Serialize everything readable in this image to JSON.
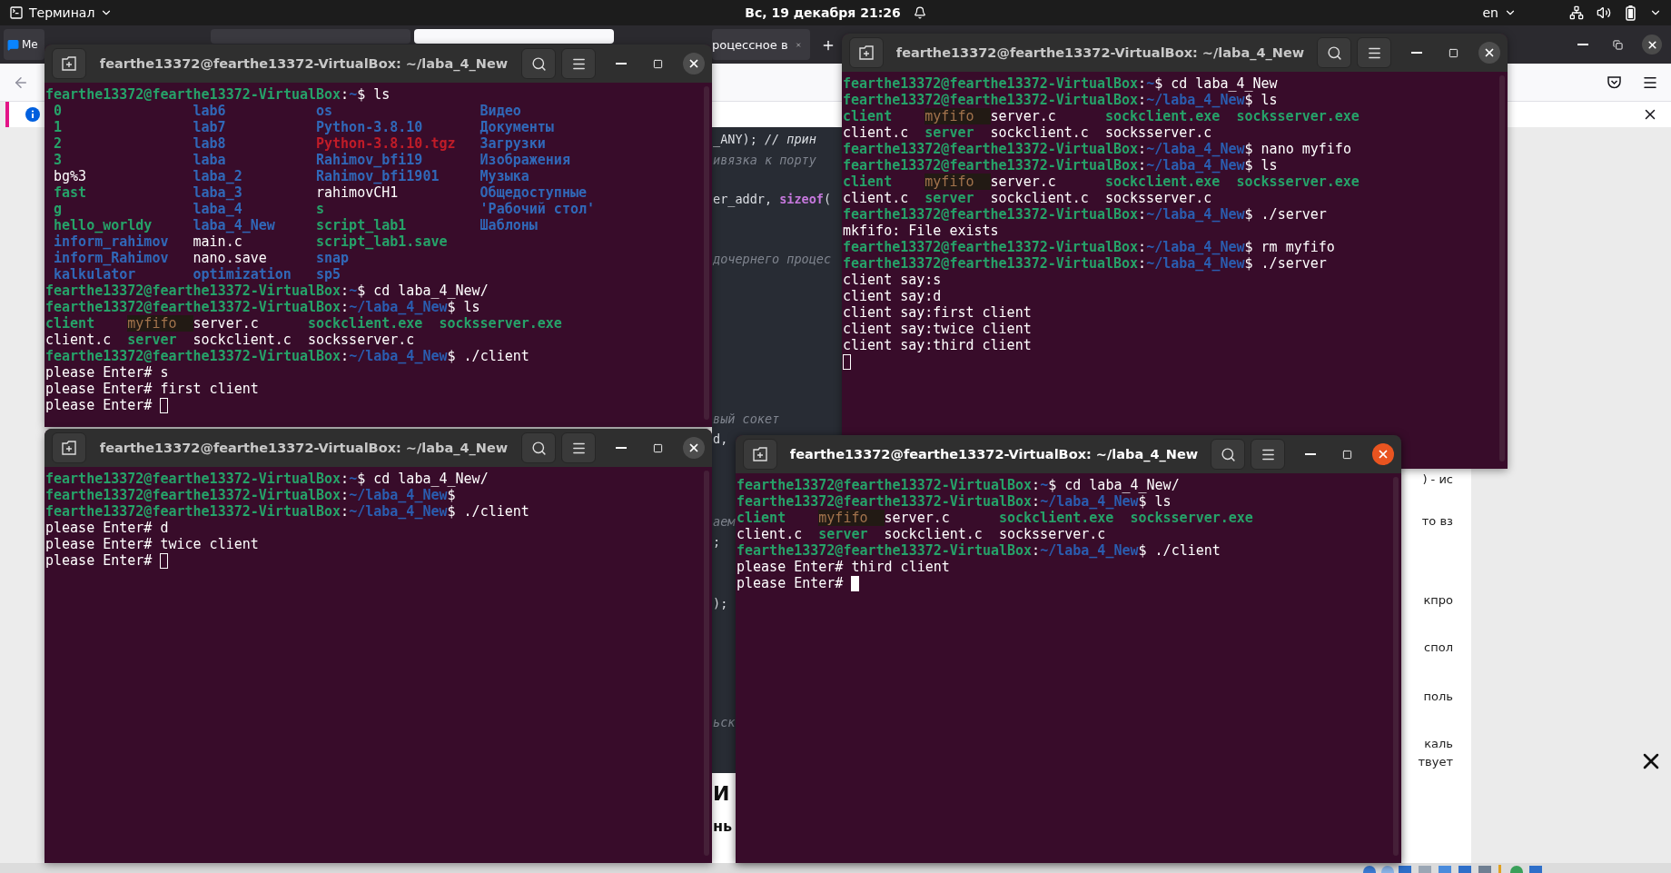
{
  "top_bar": {
    "menu": "Терминал",
    "clock": "Вс, 19 декабря 21:26",
    "language": "en"
  },
  "browser": {
    "tabs": [
      {
        "label": "Ме",
        "selected": false
      },
      {
        "selected": false
      },
      {
        "selected": true
      },
      {
        "label": "роцессное в",
        "selected": false
      }
    ],
    "code_lines": [
      {
        "text": "_ANY); *// прин*",
        "kind": "code"
      },
      {
        "text": "ивязка к порту",
        "kind": "comment"
      },
      {
        "text": "er_addr, **sizeof**(",
        "kind": "code"
      },
      {
        "text": "дочернего процес",
        "kind": "comment"
      },
      {
        "text": "вый сокет",
        "kind": "comment"
      },
      {
        "text": "d,",
        "kind": "code"
      },
      {
        "text": "аем",
        "kind": "comment"
      },
      {
        "text": ";",
        "kind": "code"
      },
      {
        "text": ");",
        "kind": "code"
      },
      {
        "text": "ьск",
        "kind": "comment"
      }
    ],
    "article_fragments": [
      "И",
      "нь"
    ],
    "list_items": [
      {
        "lines": [
          ") - ис"
        ]
      },
      {
        "lines": [
          "то вз"
        ]
      },
      {
        "lines": [
          "кпро"
        ]
      },
      {
        "lines": [
          "спол"
        ]
      },
      {
        "lines": [
          "поль"
        ]
      },
      {
        "lines": [
          "каль",
          "твует"
        ]
      }
    ]
  },
  "terminals": [
    {
      "title": "fearthe13372@fearthe13372-VirtualBox: ~/laba_4_New",
      "active": false,
      "lines": [
        {
          "segments": [
            {
              "text": "fearthe13372@fearthe13372-VirtualBox",
              "kind": "user"
            },
            {
              "text": ":",
              "kind": "plain"
            },
            {
              "text": "~",
              "kind": "path"
            },
            {
              "text": "$ ls",
              "kind": "plain"
            }
          ]
        },
        {
          "quoted": true,
          "columns": [
            [
              {
                "text": "0",
                "kind": "exec"
              },
              {
                "text": "1",
                "kind": "exec"
              },
              {
                "text": "2",
                "kind": "exec"
              },
              {
                "text": "3",
                "kind": "exec"
              },
              {
                "text": "bg%3",
                "kind": "plain"
              },
              {
                "text": "fast",
                "kind": "exec"
              },
              {
                "text": "g",
                "kind": "exec"
              },
              {
                "text": "hello_worldy",
                "kind": "exec"
              },
              {
                "text": "inform_rahimov",
                "kind": "dir"
              },
              {
                "text": "inform_Rahimov",
                "kind": "dir"
              },
              {
                "text": "kalkulator",
                "kind": "dir"
              }
            ],
            [
              {
                "text": "lab6",
                "kind": "dir"
              },
              {
                "text": "lab7",
                "kind": "dir"
              },
              {
                "text": "lab8",
                "kind": "dir"
              },
              {
                "text": "laba",
                "kind": "dir"
              },
              {
                "text": "laba_2",
                "kind": "dir"
              },
              {
                "text": "laba_3",
                "kind": "dir"
              },
              {
                "text": "laba_4",
                "kind": "dir"
              },
              {
                "text": "laba_4_New",
                "kind": "dir"
              },
              {
                "text": "main.c",
                "kind": "plain"
              },
              {
                "text": "nano.save",
                "kind": "plain"
              },
              {
                "text": "optimization",
                "kind": "dir"
              }
            ],
            [
              {
                "text": "os",
                "kind": "dir"
              },
              {
                "text": "Python-3.8.10",
                "kind": "dir"
              },
              {
                "text": "Python-3.8.10.tgz",
                "kind": "archive"
              },
              {
                "text": "Rahimov_bfi19",
                "kind": "dir"
              },
              {
                "text": "Rahimov_bfi1901",
                "kind": "dir"
              },
              {
                "text": "rahimovCH1",
                "kind": "plain"
              },
              {
                "text": "s",
                "kind": "exec"
              },
              {
                "text": "script_lab1",
                "kind": "exec"
              },
              {
                "text": "script_lab1.save",
                "kind": "exec"
              },
              {
                "text": "snap",
                "kind": "dir"
              },
              {
                "text": "sp5",
                "kind": "dir"
              }
            ],
            [
              {
                "text": "Видео",
                "kind": "dir"
              },
              {
                "text": "Документы",
                "kind": "dir"
              },
              {
                "text": "Загрузки",
                "kind": "dir"
              },
              {
                "text": "Изображения",
                "kind": "dir"
              },
              {
                "text": "Музыка",
                "kind": "dir"
              },
              {
                "text": "Общедоступные",
                "kind": "dir"
              },
              {
                "text": "'Рабочий стол'",
                "kind": "dir"
              },
              {
                "text": "Шаблоны",
                "kind": "dir"
              }
            ]
          ]
        },
        {
          "segments": [
            {
              "text": "fearthe13372@fearthe13372-VirtualBox",
              "kind": "user"
            },
            {
              "text": ":",
              "kind": "plain"
            },
            {
              "text": "~",
              "kind": "path"
            },
            {
              "text": "$ cd laba_4_New/",
              "kind": "plain"
            }
          ]
        },
        {
          "segments": [
            {
              "text": "fearthe13372@fearthe13372-VirtualBox",
              "kind": "user"
            },
            {
              "text": ":",
              "kind": "plain"
            },
            {
              "text": "~/laba_4_New",
              "kind": "path"
            },
            {
              "text": "$ ls",
              "kind": "plain"
            }
          ]
        },
        {
          "quoted": false,
          "columns": [
            [
              {
                "text": "client",
                "kind": "exec"
              },
              {
                "text": "client.c",
                "kind": "plain"
              }
            ],
            [
              {
                "text": "myfifo",
                "kind": "fifo"
              },
              {
                "text": "server",
                "kind": "exec"
              }
            ],
            [
              {
                "text": "server.c",
                "kind": "plain"
              },
              {
                "text": "sockclient.c",
                "kind": "plain"
              }
            ],
            [
              {
                "text": "sockclient.exe",
                "kind": "exec"
              },
              {
                "text": "socksserver.c",
                "kind": "plain"
              }
            ],
            [
              {
                "text": "socksserver.exe",
                "kind": "exec"
              }
            ]
          ]
        },
        {
          "segments": [
            {
              "text": "fearthe13372@fearthe13372-VirtualBox",
              "kind": "user"
            },
            {
              "text": ":",
              "kind": "plain"
            },
            {
              "text": "~/laba_4_New",
              "kind": "path"
            },
            {
              "text": "$ ./client",
              "kind": "plain"
            }
          ]
        },
        {
          "segments": [
            {
              "text": "please Enter# s",
              "kind": "plain"
            }
          ]
        },
        {
          "segments": [
            {
              "text": "please Enter# first client",
              "kind": "plain"
            }
          ]
        },
        {
          "segments": [
            {
              "text": "please Enter#",
              "kind": "plain"
            }
          ],
          "cursor": true
        }
      ]
    },
    {
      "title": "fearthe13372@fearthe13372-VirtualBox: ~/laba_4_New",
      "active": false,
      "lines": [
        {
          "segments": [
            {
              "text": "fearthe13372@fearthe13372-VirtualBox",
              "kind": "user"
            },
            {
              "text": ":",
              "kind": "plain"
            },
            {
              "text": "~",
              "kind": "path"
            },
            {
              "text": "$ cd laba_4_New",
              "kind": "plain"
            }
          ]
        },
        {
          "segments": [
            {
              "text": "fearthe13372@fearthe13372-VirtualBox",
              "kind": "user"
            },
            {
              "text": ":",
              "kind": "plain"
            },
            {
              "text": "~/laba_4_New",
              "kind": "path"
            },
            {
              "text": "$ ls",
              "kind": "plain"
            }
          ]
        },
        {
          "quoted": false,
          "columns": [
            [
              {
                "text": "client",
                "kind": "exec"
              },
              {
                "text": "client.c",
                "kind": "plain"
              }
            ],
            [
              {
                "text": "myfifo",
                "kind": "fifo"
              },
              {
                "text": "server",
                "kind": "exec"
              }
            ],
            [
              {
                "text": "server.c",
                "kind": "plain"
              },
              {
                "text": "sockclient.c",
                "kind": "plain"
              }
            ],
            [
              {
                "text": "sockclient.exe",
                "kind": "exec"
              },
              {
                "text": "socksserver.c",
                "kind": "plain"
              }
            ],
            [
              {
                "text": "socksserver.exe",
                "kind": "exec"
              }
            ]
          ]
        },
        {
          "segments": [
            {
              "text": "fearthe13372@fearthe13372-VirtualBox",
              "kind": "user"
            },
            {
              "text": ":",
              "kind": "plain"
            },
            {
              "text": "~/laba_4_New",
              "kind": "path"
            },
            {
              "text": "$ nano myfifo",
              "kind": "plain"
            }
          ]
        },
        {
          "segments": [
            {
              "text": "fearthe13372@fearthe13372-VirtualBox",
              "kind": "user"
            },
            {
              "text": ":",
              "kind": "plain"
            },
            {
              "text": "~/laba_4_New",
              "kind": "path"
            },
            {
              "text": "$ ls",
              "kind": "plain"
            }
          ]
        },
        {
          "quoted": false,
          "columns": [
            [
              {
                "text": "client",
                "kind": "exec"
              },
              {
                "text": "client.c",
                "kind": "plain"
              }
            ],
            [
              {
                "text": "myfifo",
                "kind": "fifo"
              },
              {
                "text": "server",
                "kind": "exec"
              }
            ],
            [
              {
                "text": "server.c",
                "kind": "plain"
              },
              {
                "text": "sockclient.c",
                "kind": "plain"
              }
            ],
            [
              {
                "text": "sockclient.exe",
                "kind": "exec"
              },
              {
                "text": "socksserver.c",
                "kind": "plain"
              }
            ],
            [
              {
                "text": "socksserver.exe",
                "kind": "exec"
              }
            ]
          ]
        },
        {
          "segments": [
            {
              "text": "fearthe13372@fearthe13372-VirtualBox",
              "kind": "user"
            },
            {
              "text": ":",
              "kind": "plain"
            },
            {
              "text": "~/laba_4_New",
              "kind": "path"
            },
            {
              "text": "$ ./server",
              "kind": "plain"
            }
          ]
        },
        {
          "segments": [
            {
              "text": "mkfifo: File exists",
              "kind": "plain"
            }
          ]
        },
        {
          "segments": [
            {
              "text": "fearthe13372@fearthe13372-VirtualBox",
              "kind": "user"
            },
            {
              "text": ":",
              "kind": "plain"
            },
            {
              "text": "~/laba_4_New",
              "kind": "path"
            },
            {
              "text": "$ rm myfifo",
              "kind": "plain"
            }
          ]
        },
        {
          "segments": [
            {
              "text": "fearthe13372@fearthe13372-VirtualBox",
              "kind": "user"
            },
            {
              "text": ":",
              "kind": "plain"
            },
            {
              "text": "~/laba_4_New",
              "kind": "path"
            },
            {
              "text": "$ ./server",
              "kind": "plain"
            }
          ]
        },
        {
          "segments": [
            {
              "text": "client say:s",
              "kind": "plain"
            }
          ]
        },
        {
          "segments": [
            {
              "text": "client say:d",
              "kind": "plain"
            }
          ]
        },
        {
          "segments": [
            {
              "text": "client say:first client",
              "kind": "plain"
            }
          ]
        },
        {
          "segments": [
            {
              "text": "client say:twice client",
              "kind": "plain"
            }
          ]
        },
        {
          "segments": [
            {
              "text": "client say:third client",
              "kind": "plain"
            }
          ]
        },
        {
          "cursor": true
        }
      ]
    },
    {
      "title": "fearthe13372@fearthe13372-VirtualBox: ~/laba_4_New",
      "active": false,
      "lines": [
        {
          "segments": [
            {
              "text": "fearthe13372@fearthe13372-VirtualBox",
              "kind": "user"
            },
            {
              "text": ":",
              "kind": "plain"
            },
            {
              "text": "~",
              "kind": "path"
            },
            {
              "text": "$ cd laba_4_New/",
              "kind": "plain"
            }
          ]
        },
        {
          "segments": [
            {
              "text": "fearthe13372@fearthe13372-VirtualBox",
              "kind": "user"
            },
            {
              "text": ":",
              "kind": "plain"
            },
            {
              "text": "~/laba_4_New",
              "kind": "path"
            },
            {
              "text": "$",
              "kind": "plain"
            }
          ]
        },
        {
          "segments": [
            {
              "text": "fearthe13372@fearthe13372-VirtualBox",
              "kind": "user"
            },
            {
              "text": ":",
              "kind": "plain"
            },
            {
              "text": "~/laba_4_New",
              "kind": "path"
            },
            {
              "text": "$ ./client",
              "kind": "plain"
            }
          ]
        },
        {
          "segments": [
            {
              "text": "please Enter# d",
              "kind": "plain"
            }
          ]
        },
        {
          "segments": [
            {
              "text": "please Enter# twice client",
              "kind": "plain"
            }
          ]
        },
        {
          "segments": [
            {
              "text": "please Enter#",
              "kind": "plain"
            }
          ],
          "cursor": true
        }
      ]
    },
    {
      "title": "fearthe13372@fearthe13372-VirtualBox: ~/laba_4_New",
      "active": true,
      "lines": [
        {
          "segments": [
            {
              "text": "fearthe13372@fearthe13372-VirtualBox",
              "kind": "user"
            },
            {
              "text": ":",
              "kind": "plain"
            },
            {
              "text": "~",
              "kind": "path"
            },
            {
              "text": "$ cd laba_4_New/",
              "kind": "plain"
            }
          ]
        },
        {
          "segments": [
            {
              "text": "fearthe13372@fearthe13372-VirtualBox",
              "kind": "user"
            },
            {
              "text": ":",
              "kind": "plain"
            },
            {
              "text": "~/laba_4_New",
              "kind": "path"
            },
            {
              "text": "$ ls",
              "kind": "plain"
            }
          ]
        },
        {
          "quoted": false,
          "columns": [
            [
              {
                "text": "client",
                "kind": "exec"
              },
              {
                "text": "client.c",
                "kind": "plain"
              }
            ],
            [
              {
                "text": "myfifo",
                "kind": "fifo"
              },
              {
                "text": "server",
                "kind": "exec"
              }
            ],
            [
              {
                "text": "server.c",
                "kind": "plain"
              },
              {
                "text": "sockclient.c",
                "kind": "plain"
              }
            ],
            [
              {
                "text": "sockclient.exe",
                "kind": "exec"
              },
              {
                "text": "socksserver.c",
                "kind": "plain"
              }
            ],
            [
              {
                "text": "socksserver.exe",
                "kind": "exec"
              }
            ]
          ]
        },
        {
          "segments": [
            {
              "text": "fearthe13372@fearthe13372-VirtualBox",
              "kind": "user"
            },
            {
              "text": ":",
              "kind": "plain"
            },
            {
              "text": "~/laba_4_New",
              "kind": "path"
            },
            {
              "text": "$ ./client",
              "kind": "plain"
            }
          ]
        },
        {
          "segments": [
            {
              "text": "please Enter# third client",
              "kind": "plain"
            }
          ]
        },
        {
          "segments": [
            {
              "text": "please Enter#",
              "kind": "plain"
            }
          ],
          "cursor": true
        }
      ]
    }
  ]
}
